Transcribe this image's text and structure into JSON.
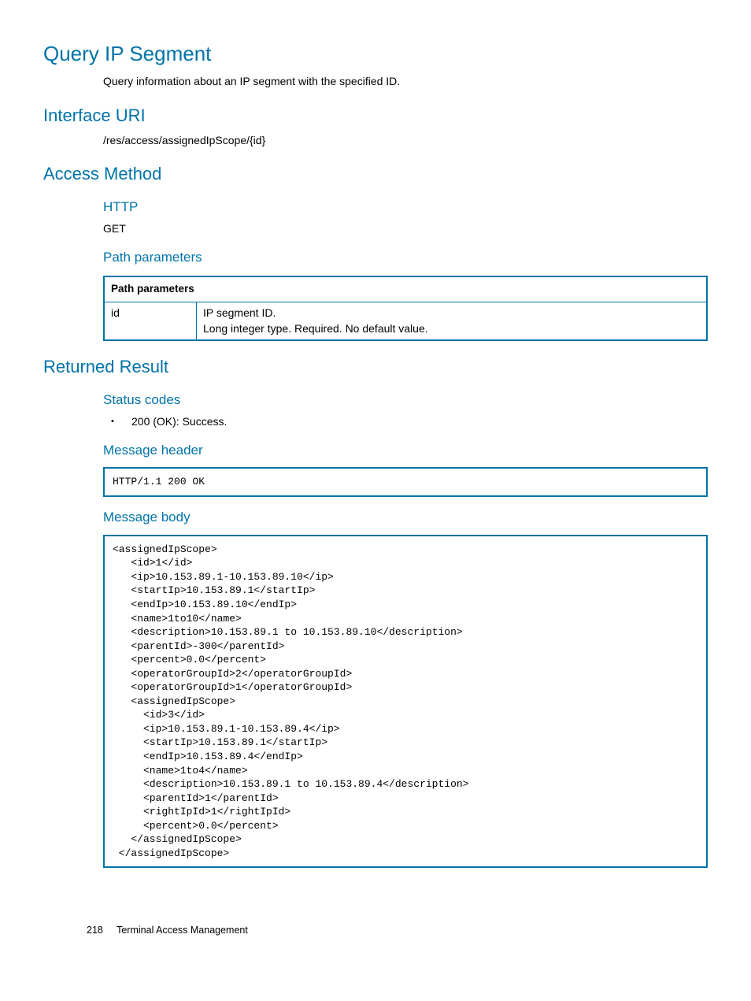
{
  "title": "Query IP Segment",
  "description": "Query information about an IP segment with the specified ID.",
  "sections": {
    "interface_uri": {
      "heading": "Interface URI",
      "value": "/res/access/assignedIpScope/{id}"
    },
    "access_method": {
      "heading": "Access Method",
      "http_heading": "HTTP",
      "http_value": "GET",
      "path_params_heading": "Path parameters",
      "table": {
        "header": "Path parameters",
        "rows": [
          {
            "name": "id",
            "desc1": "IP segment ID.",
            "desc2": "Long integer type. Required. No default value."
          }
        ]
      }
    },
    "returned_result": {
      "heading": "Returned Result",
      "status_codes_heading": "Status codes",
      "status_codes": [
        "200 (OK): Success."
      ],
      "message_header_heading": "Message header",
      "message_header_code": "HTTP/1.1 200 OK",
      "message_body_heading": "Message body",
      "message_body_code": "<assignedIpScope>\n   <id>1</id>\n   <ip>10.153.89.1-10.153.89.10</ip>\n   <startIp>10.153.89.1</startIp>\n   <endIp>10.153.89.10</endIp>\n   <name>1to10</name>\n   <description>10.153.89.1 to 10.153.89.10</description>\n   <parentId>-300</parentId>\n   <percent>0.0</percent>\n   <operatorGroupId>2</operatorGroupId>\n   <operatorGroupId>1</operatorGroupId>\n   <assignedIpScope>\n     <id>3</id>\n     <ip>10.153.89.1-10.153.89.4</ip>\n     <startIp>10.153.89.1</startIp>\n     <endIp>10.153.89.4</endIp>\n     <name>1to4</name>\n     <description>10.153.89.1 to 10.153.89.4</description>\n     <parentId>1</parentId>\n     <rightIpId>1</rightIpId>\n     <percent>0.0</percent>\n   </assignedIpScope>\n </assignedIpScope>"
    }
  },
  "footer": {
    "page_number": "218",
    "chapter": "Terminal Access Management"
  }
}
